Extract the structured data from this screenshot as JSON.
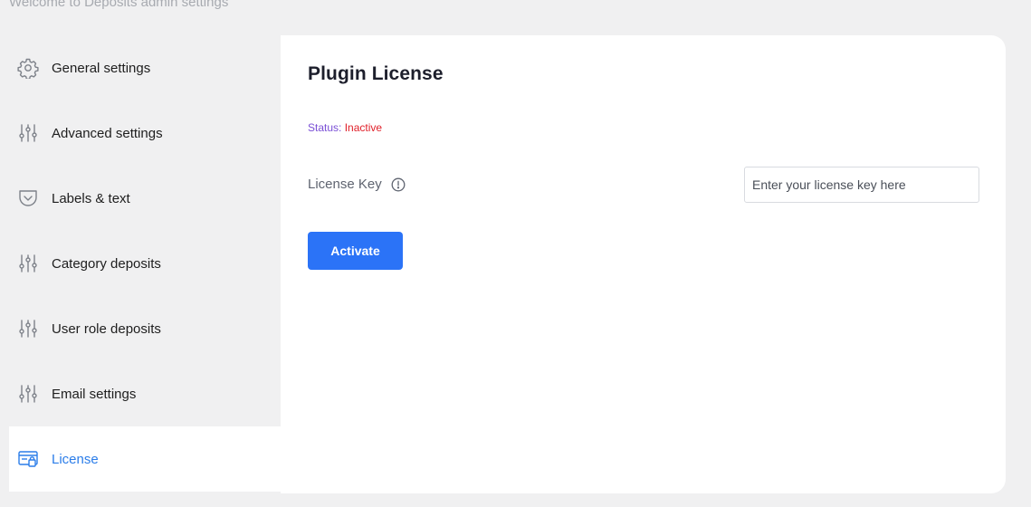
{
  "header": {
    "welcome_text": "Welcome to Deposits admin settings"
  },
  "sidebar": {
    "items": [
      {
        "label": "General settings",
        "icon": "gear-icon"
      },
      {
        "label": "Advanced settings",
        "icon": "sliders-icon"
      },
      {
        "label": "Labels & text",
        "icon": "pocket-icon"
      },
      {
        "label": "Category deposits",
        "icon": "sliders-icon"
      },
      {
        "label": "User role deposits",
        "icon": "sliders-icon"
      },
      {
        "label": "Email settings",
        "icon": "sliders-icon"
      },
      {
        "label": "License",
        "icon": "license-card-icon",
        "active": true
      }
    ]
  },
  "main": {
    "title": "Plugin License",
    "status_label": "Status:",
    "status_value": "Inactive",
    "license_key_label": "License Key",
    "license_key_placeholder": "Enter your license key here",
    "license_key_value": "",
    "activate_label": "Activate"
  },
  "colors": {
    "accent": "#2b73f7",
    "active_nav": "#2b7de9",
    "status_inactive": "#e0202a",
    "status_label": "#7a4fd6",
    "page_bg": "#f0f0f1"
  }
}
